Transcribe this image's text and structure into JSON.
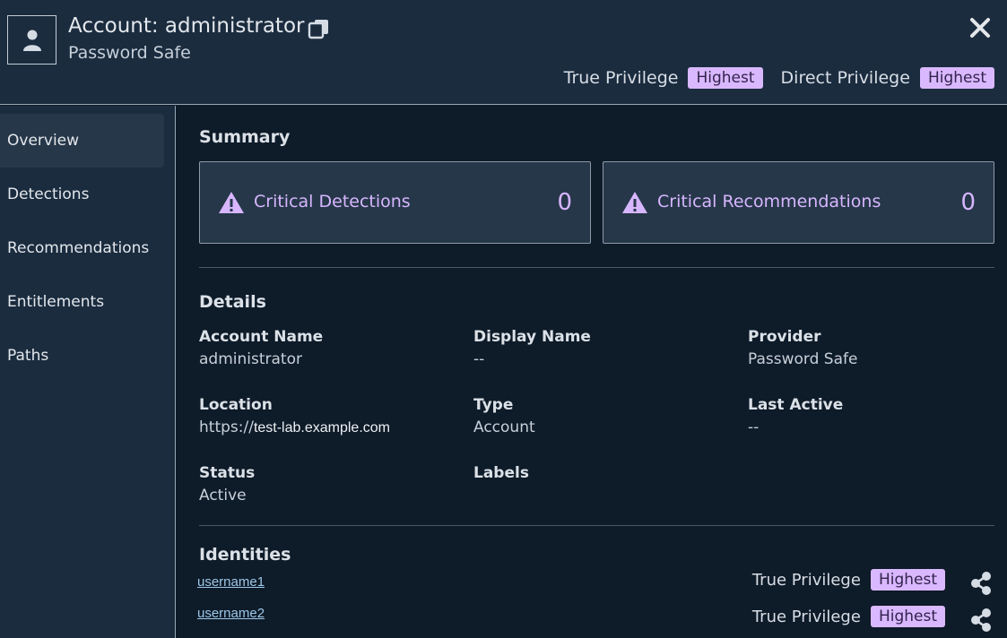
{
  "header": {
    "title": "Account: administrator",
    "subtitle": "Password Safe",
    "true_privilege_label": "True Privilege",
    "true_privilege_value": "Highest",
    "direct_privilege_label": "Direct Privilege",
    "direct_privilege_value": "Highest",
    "icons": {
      "avatar": "user-icon",
      "copy": "copy-icon",
      "close": "close-icon"
    }
  },
  "sidebar": {
    "items": [
      {
        "label": "Overview",
        "active": true
      },
      {
        "label": "Detections",
        "active": false
      },
      {
        "label": "Recommendations",
        "active": false
      },
      {
        "label": "Entitlements",
        "active": false
      },
      {
        "label": "Paths",
        "active": false
      }
    ]
  },
  "summary": {
    "title": "Summary",
    "cards": [
      {
        "label": "Critical Detections",
        "value": "0",
        "icon": "warning-icon"
      },
      {
        "label": "Critical Recommendations",
        "value": "0",
        "icon": "warning-icon"
      }
    ]
  },
  "details": {
    "title": "Details",
    "account_name": {
      "label": "Account Name",
      "value": "administrator"
    },
    "display_name": {
      "label": "Display Name",
      "value": "--"
    },
    "provider": {
      "label": "Provider",
      "value": "Password Safe"
    },
    "location": {
      "label": "Location",
      "prefix": "https://",
      "host": "test-lab.example.com"
    },
    "type": {
      "label": "Type",
      "value": "Account"
    },
    "last_active": {
      "label": "Last Active",
      "value": "--"
    },
    "status": {
      "label": "Status",
      "value": "Active"
    },
    "labels": {
      "label": "Labels"
    }
  },
  "identities": {
    "title": "Identities",
    "rows": [
      {
        "name": "username1",
        "privilege_label": "True Privilege",
        "privilege_value": "Highest",
        "icon": "share-icon"
      },
      {
        "name": "username2",
        "privilege_label": "True Privilege",
        "privilege_value": "Highest",
        "icon": "share-icon"
      }
    ]
  },
  "colors": {
    "background": "#0e1b29",
    "panel": "#1b2c3f",
    "card": "#263749",
    "accent": "#d7b6ff",
    "badge_bg": "#d9b8ff",
    "link": "#9ec7e6"
  }
}
